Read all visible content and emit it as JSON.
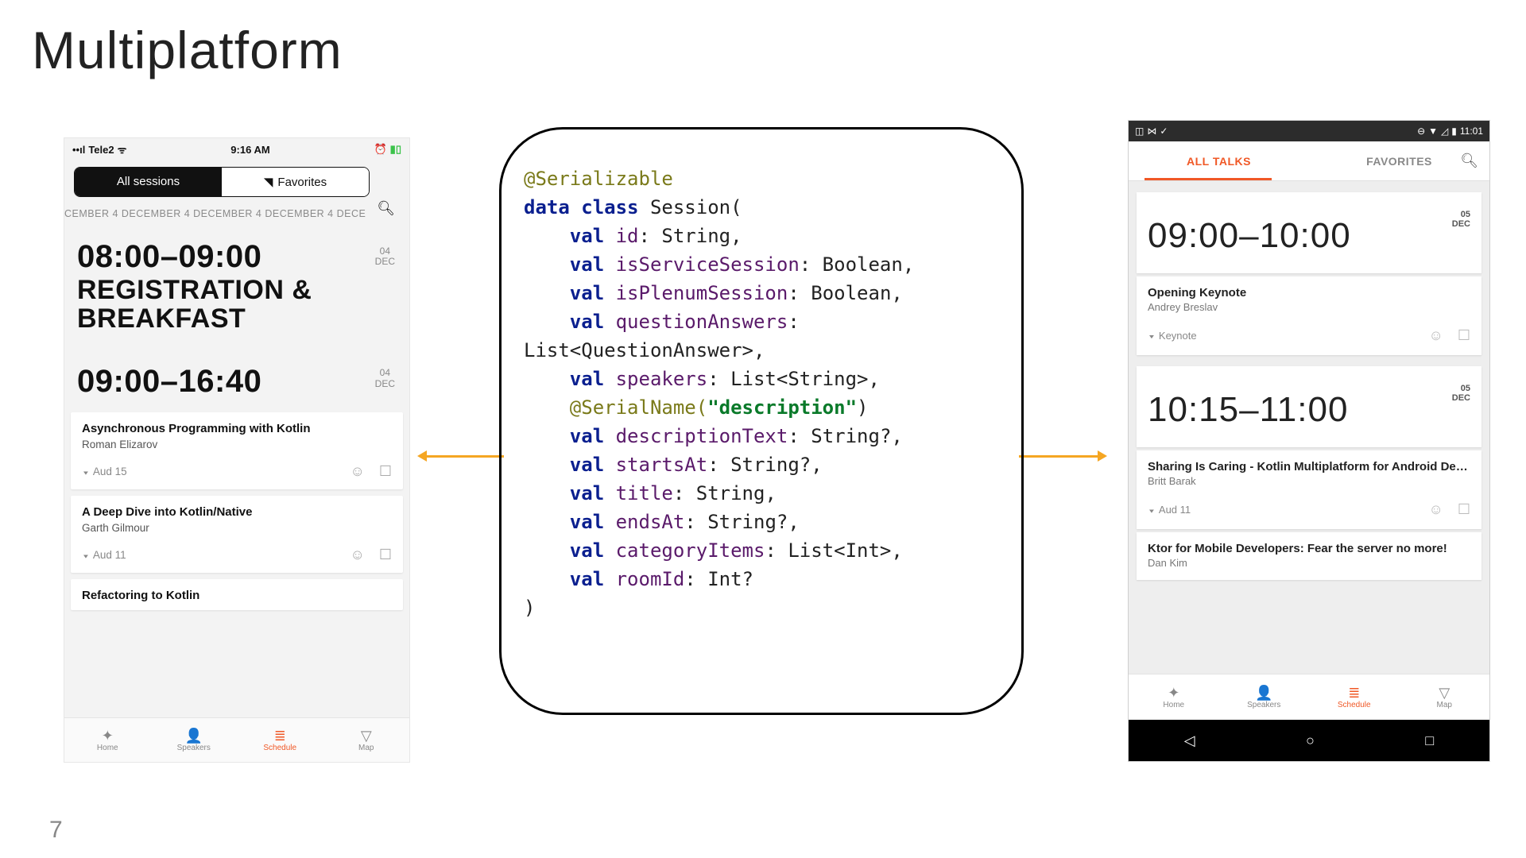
{
  "slide": {
    "title": "Multiplatform",
    "page": "7"
  },
  "ios": {
    "status": {
      "carrier": "Tele2",
      "time": "9:16 AM"
    },
    "seg": [
      "All sessions",
      "Favorites"
    ],
    "daterow": "CEMBER 4 DECEMBER 4 DECEMBER 4 DECEMBER 4 DECE",
    "block1": {
      "time": "08:00–09:00",
      "title1": "REGISTRATION &",
      "title2": "BREAKFAST",
      "d1": "04",
      "d2": "DEC"
    },
    "block2": {
      "time": "09:00–16:40",
      "d1": "04",
      "d2": "DEC"
    },
    "cards": [
      {
        "title": "Asynchronous Programming with Kotlin",
        "speaker": "Roman Elizarov",
        "room": "Aud 15"
      },
      {
        "title": "A Deep Dive into Kotlin/Native",
        "speaker": "Garth Gilmour",
        "room": "Aud 11"
      },
      {
        "title": "Refactoring to Kotlin",
        "speaker": "",
        "room": ""
      }
    ],
    "tabs": [
      "Home",
      "Speakers",
      "Schedule",
      "Map"
    ]
  },
  "code": {
    "l1a": "@Serializable",
    "l2a": "data class ",
    "l2b": "Session(",
    "l3a": "    val ",
    "l3b": "id",
    "l3c": ": String,",
    "l4a": "    val ",
    "l4b": "isServiceSession",
    "l4c": ": Boolean,",
    "l5a": "    val ",
    "l5b": "isPlenumSession",
    "l5c": ": Boolean,",
    "l6a": "    val ",
    "l6b": "questionAnswers",
    "l6c": ":",
    "l7": "List<QuestionAnswer>,",
    "l8a": "    val ",
    "l8b": "speakers",
    "l8c": ": List<String>,",
    "l9a": "    @SerialName(",
    "l9b": "\"description\"",
    "l9c": ")",
    "l10a": "    val ",
    "l10b": "descriptionText",
    "l10c": ": String?,",
    "l11a": "    val ",
    "l11b": "startsAt",
    "l11c": ": String?,",
    "l12a": "    val ",
    "l12b": "title",
    "l12c": ": String,",
    "l13a": "    val ",
    "l13b": "endsAt",
    "l13c": ": String?,",
    "l14a": "    val ",
    "l14b": "categoryItems",
    "l14c": ": List<Int>,",
    "l15a": "    val ",
    "l15b": "roomId",
    "l15c": ": Int?",
    "l16": ")"
  },
  "android": {
    "status": {
      "time": "11:01"
    },
    "tabs": [
      "ALL TALKS",
      "FAVORITES"
    ],
    "block1": {
      "time": "09:00–10:00",
      "d1": "05",
      "d2": "DEC"
    },
    "block2": {
      "time": "10:15–11:00",
      "d1": "05",
      "d2": "DEC"
    },
    "cards": [
      {
        "title": "Opening Keynote",
        "speaker": "Andrey Breslav",
        "room": "Keynote"
      },
      {
        "title": "Sharing Is Caring - Kotlin Multiplatform for Android De…",
        "speaker": "Britt Barak",
        "room": "Aud 11"
      },
      {
        "title": "Ktor for Mobile Developers: Fear the server no more!",
        "speaker": "Dan Kim",
        "room": ""
      }
    ],
    "tabbar": [
      "Home",
      "Speakers",
      "Schedule",
      "Map"
    ]
  }
}
